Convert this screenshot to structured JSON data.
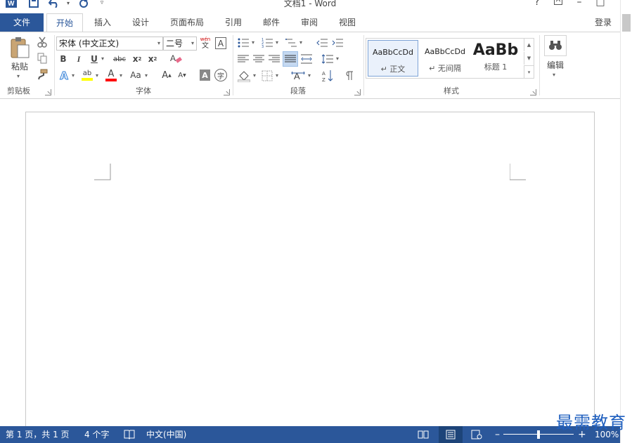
{
  "window": {
    "title": "文档1 - Word",
    "controls": {
      "help": "?",
      "ribbon_display": "▣",
      "minimize": "–",
      "maximize": "□",
      "close": "×"
    }
  },
  "quick_access": {
    "app_icon": "W",
    "save": "💾",
    "undo": "↶",
    "redo": "↻",
    "customize": "⩡"
  },
  "tabs": [
    {
      "label": "文件"
    },
    {
      "label": "开始"
    },
    {
      "label": "插入"
    },
    {
      "label": "设计"
    },
    {
      "label": "页面布局"
    },
    {
      "label": "引用"
    },
    {
      "label": "邮件"
    },
    {
      "label": "审阅"
    },
    {
      "label": "视图"
    }
  ],
  "login": "登录",
  "ribbon": {
    "clipboard": {
      "label": "剪贴板",
      "paste": "粘贴"
    },
    "font": {
      "label": "字体",
      "font_name": "宋体 (中文正文)",
      "font_size": "二号",
      "phonetic_top": "wén",
      "phonetic_bottom": "文",
      "char_border": "A",
      "bold": "B",
      "italic": "I",
      "underline": "U",
      "strike": "abc",
      "subscript_base": "x",
      "subscript_sub": "2",
      "superscript_base": "x",
      "superscript_sup": "2",
      "text_effect": "A",
      "highlight": "ab",
      "font_color": "A",
      "change_case": "Aa",
      "grow": "A",
      "shrink": "A",
      "char_shading": "A",
      "enclose": "字"
    },
    "paragraph": {
      "label": "段落"
    },
    "styles": {
      "label": "样式",
      "items": [
        {
          "sample": "AaBbCcDd",
          "name": "↵ 正文"
        },
        {
          "sample": "AaBbCcDd",
          "name": "↵ 无间隔"
        },
        {
          "sample": "AaBb",
          "name": "标题 1"
        }
      ]
    },
    "editing": {
      "label": "编辑"
    }
  },
  "status": {
    "page": "第 1 页，共 1 页",
    "words": "4 个字",
    "language": "中文(中国)",
    "zoom": "100%",
    "zoom_minus": "–",
    "zoom_plus": "+"
  },
  "watermark": "最需教育",
  "colors": {
    "brand": "#2b579a",
    "highlight": "#ffff00",
    "font_color": "#ff0000",
    "watermark": "#1f5fbf"
  }
}
